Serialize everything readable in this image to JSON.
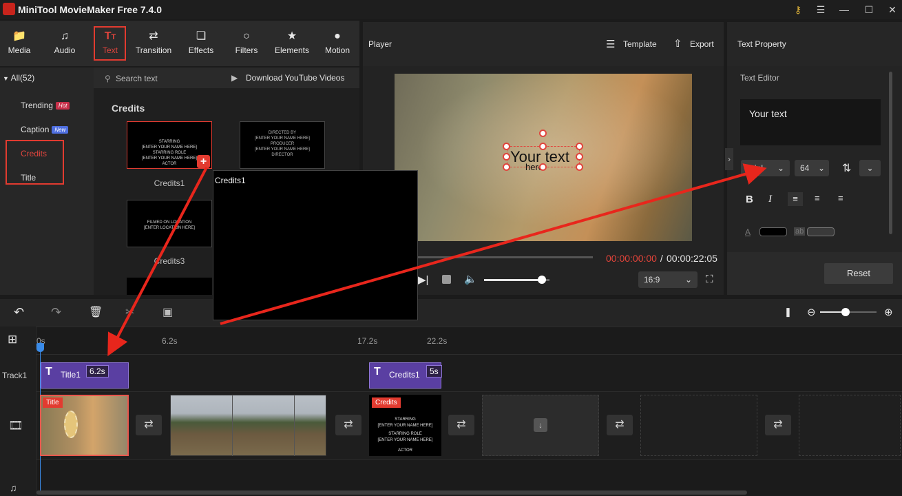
{
  "app": {
    "title": "MiniTool MovieMaker Free 7.4.0",
    "window_icons": [
      "key-icon",
      "menu-icon",
      "minimize-icon",
      "maximize-icon",
      "close-icon"
    ]
  },
  "toolbar": {
    "items": [
      {
        "label": "Media",
        "icon": "media-folder-icon"
      },
      {
        "label": "Audio",
        "icon": "music-note-icon"
      },
      {
        "label": "Text",
        "icon": "text-icon",
        "active": true
      },
      {
        "label": "Transition",
        "icon": "transition-icon"
      },
      {
        "label": "Effects",
        "icon": "effects-icon"
      },
      {
        "label": "Filters",
        "icon": "filters-icon"
      },
      {
        "label": "Elements",
        "icon": "elements-icon"
      },
      {
        "label": "Motion",
        "icon": "motion-icon"
      }
    ]
  },
  "sidebar": {
    "all_label": "All(52)",
    "items": [
      {
        "label": "Trending",
        "badge": "Hot"
      },
      {
        "label": "Caption",
        "badge": "New"
      },
      {
        "label": "Credits",
        "active": true
      },
      {
        "label": "Title"
      }
    ]
  },
  "content": {
    "search_placeholder": "Search text",
    "download_label": "Download YouTube Videos",
    "section_title": "Credits",
    "thumbnails": [
      {
        "caption": "Credits1",
        "lines": [
          "STARRING",
          "[ENTER YOUR NAME HERE]",
          "STARRING ROLE",
          "[ENTER YOUR NAME HERE]",
          "ACTOR"
        ]
      },
      {
        "caption": "",
        "lines": [
          "DIRECTED BY",
          "[ENTER YOUR NAME HERE]",
          "PRODUCER",
          "[ENTER YOUR NAME HERE]",
          "DIRECTOR"
        ]
      },
      {
        "caption": "Credits3",
        "lines": [
          "FILMED ON LOCATION",
          "[ENTER LOCATION HERE]"
        ]
      }
    ],
    "preview_label": "Credits1"
  },
  "player": {
    "title": "Player",
    "template_label": "Template",
    "export_label": "Export",
    "overlay_text": "Your text",
    "overlay_subtext": "here",
    "current_time": "00:00:00:00",
    "separator": " / ",
    "total_time": "00:00:22:05",
    "aspect_ratio": "16:9",
    "volume": 0.88
  },
  "text_property": {
    "title": "Text Property",
    "editor_label": "Text Editor",
    "editor_value": "Your text",
    "font": "Arial",
    "size": "64",
    "reset_label": "Reset"
  },
  "timeline": {
    "ticks": [
      "0s",
      "6.2s",
      "17.2s",
      "22.2s"
    ],
    "track_label": "Track1",
    "text_clips": [
      {
        "name": "Title1",
        "duration": "6.2s"
      },
      {
        "name": "Credits1",
        "duration": "5s"
      }
    ],
    "video_labels": [
      "Title",
      "Credits"
    ],
    "credit_lines": [
      "STARRING",
      "[ENTER YOUR NAME HERE]",
      "STARRING ROLE",
      "[ENTER YOUR NAME HERE]",
      "ACTOR"
    ]
  },
  "colors": {
    "accent_red": "#e23b30",
    "clip_purple": "#5a3fa2",
    "hot_badge": "#c8304a",
    "new_badge": "#4f6fe0"
  }
}
